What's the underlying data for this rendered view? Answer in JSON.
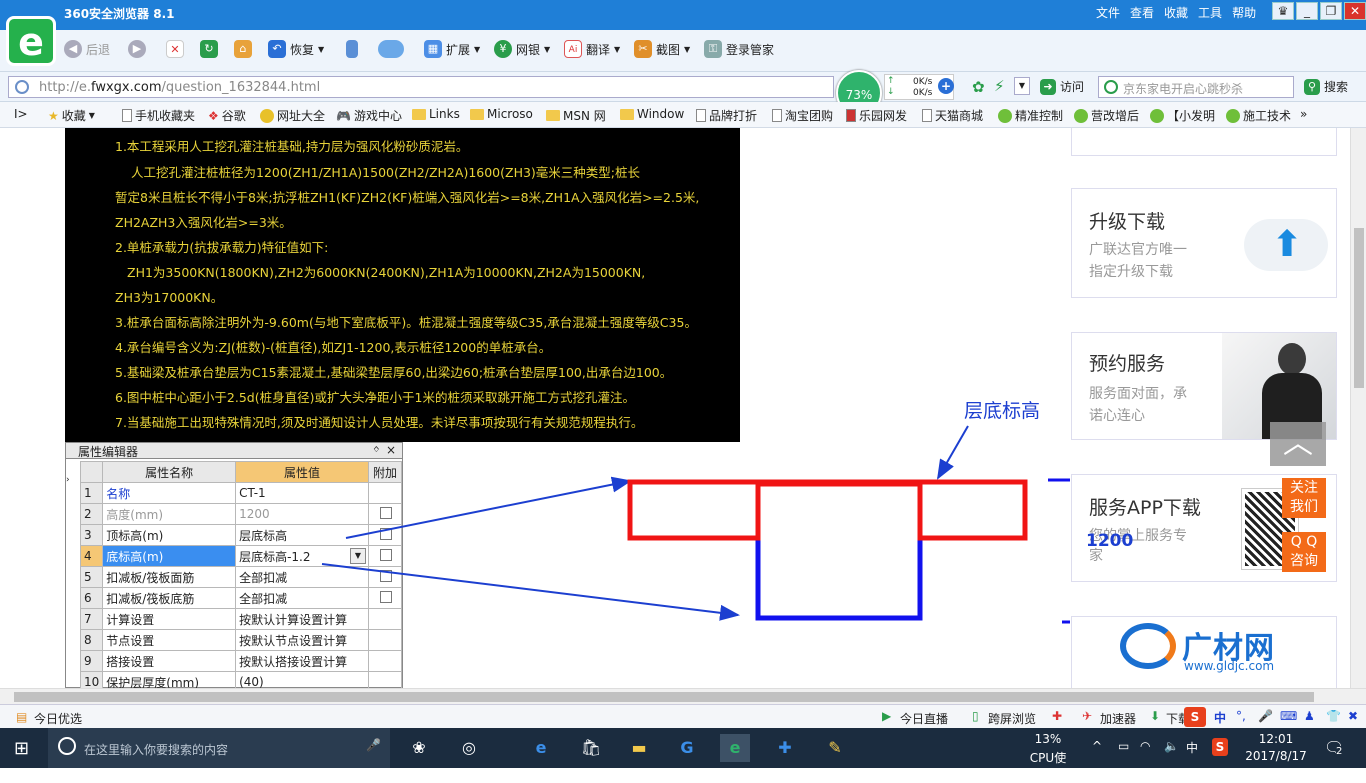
{
  "window": {
    "title": "360安全浏览器 8.1",
    "menu": [
      "文件",
      "查看",
      "收藏",
      "工具",
      "帮助"
    ]
  },
  "toolbar": {
    "back": "后退",
    "restore": "恢复",
    "extend": "扩展",
    "bank": "网银",
    "translate": "翻译",
    "screenshot": "截图",
    "login": "登录管家",
    "visit": "访问",
    "search_btn": "搜索"
  },
  "address": {
    "url_prefix": "http://e.",
    "url_domain": "fwxgx.com",
    "url_path": "/question_1632844.html",
    "cpu_percent": "73%",
    "net_up": "0K/s",
    "net_down": "0K/s",
    "search_placeholder": "京东家电开启心跳秒杀"
  },
  "bookmarks": [
    "收藏",
    "手机收藏夹",
    "谷歌",
    "网址大全",
    "游戏中心",
    "Links",
    "Microso",
    "MSN 网",
    "Window",
    "品牌打折",
    "淘宝团购",
    "乐园网发",
    "天猫商城",
    "精准控制",
    "营改增后",
    "【小发明",
    "施工技术"
  ],
  "notes": [
    "1.本工程采用人工挖孔灌注桩基础,持力层为强风化粉砂质泥岩。",
    "人工挖孔灌注桩桩径为1200(ZH1/ZH1A)1500(ZH2/ZH2A)1600(ZH3)毫米三种类型;桩长",
    "暂定8米且桩长不得小于8米;抗浮桩ZH1(KF)ZH2(KF)桩端入强风化岩>=8米,ZH1A入强风化岩>=2.5米,",
    "ZH2AZH3入强风化岩>=3米。",
    "2.单桩承载力(抗拔承载力)特征值如下:",
    "ZH1为3500KN(1800KN),ZH2为6000KN(2400KN),ZH1A为10000KN,ZH2A为15000KN,",
    "ZH3为17000KN。",
    "3.桩承台面标高除注明外为-9.60m(与地下室底板平)。桩混凝土强度等级C35,承台混凝土强度等级C35。",
    "4.承台编号含义为:ZJ(桩数)-(桩直径),如ZJ1-1200,表示桩径1200的单桩承台。",
    "5.基础梁及桩承台垫层为C15素混凝土,基础梁垫层厚60,出梁边60;桩承台垫层厚100,出承台边100。",
    "6.图中桩中心距小于2.5d(桩身直径)或扩大头净距小于1米的桩须采取跳开施工方式挖孔灌注。",
    "7.当基础施工出现特殊情况时,须及时通知设计人员处理。未详尽事项按现行有关规范规程执行。"
  ],
  "prop_editor": {
    "title": "属性编辑器",
    "pin": "ᛜ",
    "close": "×",
    "headers": [
      "属性名称",
      "属性值",
      "附加"
    ],
    "rows": [
      {
        "no": "1",
        "name": "名称",
        "value": "CT-1"
      },
      {
        "no": "2",
        "name": "高度(mm)",
        "value": "1200"
      },
      {
        "no": "3",
        "name": "顶标高(m)",
        "value": "层底标高"
      },
      {
        "no": "4",
        "name": "底标高(m)",
        "value": "层底标高-1.2"
      },
      {
        "no": "5",
        "name": "扣减板/筏板面筋",
        "value": "全部扣减"
      },
      {
        "no": "6",
        "name": "扣减板/筏板底筋",
        "value": "全部扣减"
      },
      {
        "no": "7",
        "name": "计算设置",
        "value": "按默认计算设置计算"
      },
      {
        "no": "8",
        "name": "节点设置",
        "value": "按默认节点设置计算"
      },
      {
        "no": "9",
        "name": "搭接设置",
        "value": "按默认搭接设置计算"
      },
      {
        "no": "10",
        "name": "保护层厚度(mm)",
        "value": "(40)"
      }
    ]
  },
  "diagram": {
    "label_top": "层底标高",
    "label_dim": "1200"
  },
  "sidebar": {
    "upgrade_title": "升级下载",
    "upgrade_desc1": "广联达官方唯一",
    "upgrade_desc2": "指定升级下载",
    "booking_title": "预约服务",
    "booking_desc1": "服务面对面，承",
    "booking_desc2": "诺心连心",
    "app_title": "服务APP下载",
    "app_desc1": "您的掌上服务专",
    "app_desc2": "家",
    "follow1": "关注",
    "follow2": "我们",
    "qq1": "Q Q",
    "qq2": "咨询",
    "brand": "广材网",
    "brand_url": "www.gldjc.com"
  },
  "statusbar": {
    "left": "今日优选",
    "live": "今日直播",
    "crossscreen": "跨屏浏览",
    "accelerator": "加速器",
    "download": "下载",
    "ime": "中"
  },
  "taskbar": {
    "search_placeholder": "在这里输入你要搜索的内容",
    "cpu_percent": "13%",
    "cpu_label": "CPU使用",
    "ime": "中",
    "time": "12:01",
    "date": "2017/8/17",
    "notifications": "2"
  }
}
